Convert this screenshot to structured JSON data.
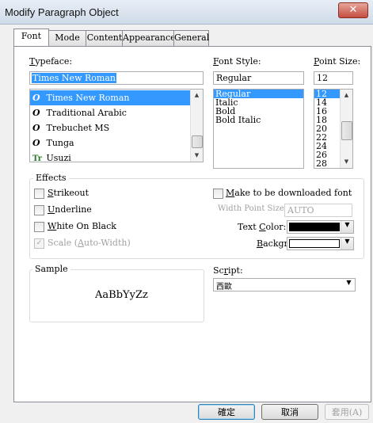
{
  "window": {
    "title": "Modify Paragraph Object",
    "close_glyph": "✕"
  },
  "tabs": [
    "Font",
    "Mode",
    "Content",
    "Appearance",
    "General"
  ],
  "typeface": {
    "label_u": "T",
    "label_rest": "ypeface:",
    "value": "Times New Roman",
    "items": [
      {
        "icon": "opentype-icon",
        "glyph": "O",
        "name": "Times New Roman"
      },
      {
        "icon": "opentype-icon",
        "glyph": "O",
        "name": "Traditional Arabic"
      },
      {
        "icon": "opentype-icon",
        "glyph": "O",
        "name": "Trebuchet MS"
      },
      {
        "icon": "opentype-icon",
        "glyph": "O",
        "name": "Tunga"
      },
      {
        "icon": "truetype-icon",
        "glyph": "Tr",
        "name": "Usuzi"
      }
    ]
  },
  "font_style": {
    "label_u": "F",
    "label_rest": "ont Style:",
    "value": "Regular",
    "items": [
      "Regular",
      "Italic",
      "Bold",
      "Bold Italic"
    ]
  },
  "point_size": {
    "label_u": "P",
    "label_rest": "oint Size:",
    "value": "12",
    "items": [
      "12",
      "14",
      "16",
      "18",
      "20",
      "22",
      "24",
      "26",
      "28"
    ]
  },
  "effects": {
    "title": "Effects",
    "strikeout": {
      "u": "S",
      "rest": "trikeout"
    },
    "underline": {
      "u": "U",
      "rest": "nderline"
    },
    "white_on_black": {
      "u": "W",
      "rest": "hite On Black"
    },
    "scale": {
      "pre": "Scale (",
      "u": "A",
      "rest": "uto-Width)"
    },
    "download": {
      "pre": "M",
      "rest": "ake to be downloaded font"
    },
    "width_point_size": {
      "label": "Width Point Size:",
      "value": "AUTO"
    },
    "text_color": {
      "pre": "Text ",
      "u": "C",
      "rest": "olor:",
      "color": "#000000"
    },
    "background": {
      "u": "B",
      "rest": "ackground",
      "color": "#ffffff"
    }
  },
  "sample": {
    "title": "Sample",
    "text": "AaBbYyZz"
  },
  "script": {
    "label_pre": "Sc",
    "label_u": "r",
    "label_rest": "ipt:",
    "value": "西歐"
  },
  "buttons": {
    "ok": "確定",
    "cancel": "取消",
    "apply": "套用(A)"
  },
  "colors": {
    "accent": "#3399ff",
    "titlebar": "#cfdbe9"
  }
}
